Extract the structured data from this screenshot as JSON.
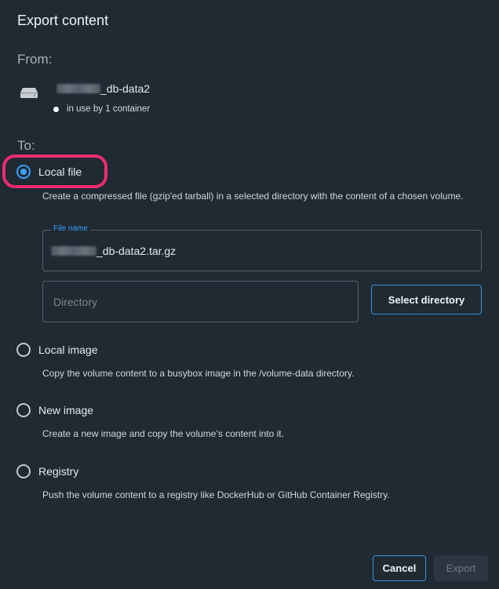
{
  "dialog": {
    "title": "Export content",
    "from_label": "From:",
    "to_label": "To:"
  },
  "volume": {
    "name_suffix": "_db-data2",
    "status": "in use by 1 container",
    "icon": "disk-icon"
  },
  "options": [
    {
      "label": "Local file",
      "selected": true,
      "description": "Create a compressed file (gzip'ed tarball) in a selected directory with the content of a chosen volume."
    },
    {
      "label": "Local image",
      "selected": false,
      "description": "Copy the volume content to a busybox image in the /volume-data directory."
    },
    {
      "label": "New image",
      "selected": false,
      "description": "Create a new image and copy the volume’s content into it."
    },
    {
      "label": "Registry",
      "selected": false,
      "description": "Push the volume content to a registry like DockerHub or GitHub Container Registry."
    }
  ],
  "file_name": {
    "legend": "File name",
    "value_suffix": "_db-data2.tar.gz"
  },
  "directory": {
    "placeholder": "Directory",
    "button_label": "Select directory"
  },
  "footer": {
    "cancel_label": "Cancel",
    "export_label": "Export"
  },
  "colors": {
    "accent": "#3ba0ff",
    "highlight": "#ec2c6f",
    "background": "#1f2a33"
  }
}
